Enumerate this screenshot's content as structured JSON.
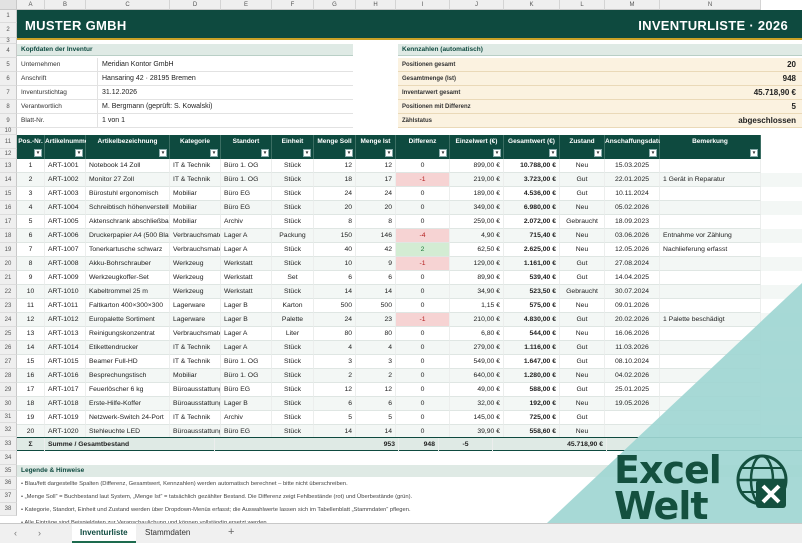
{
  "columns": [
    "A",
    "B",
    "C",
    "D",
    "E",
    "F",
    "G",
    "H",
    "I",
    "J",
    "K",
    "L",
    "M",
    "N"
  ],
  "rows": [
    "1",
    "2",
    "3",
    "4",
    "5",
    "6",
    "7",
    "8",
    "9",
    "10",
    "11",
    "12",
    "13",
    "14",
    "15",
    "16",
    "17",
    "18",
    "19",
    "20",
    "21",
    "22",
    "23",
    "24",
    "25",
    "26",
    "27",
    "28",
    "29",
    "30",
    "31",
    "32",
    "33",
    "34",
    "35",
    "36",
    "37",
    "38"
  ],
  "banner": {
    "company": "MUSTER GMBH",
    "title": "INVENTURLISTE  ·  2026"
  },
  "header_block": {
    "title": "Kopfdaten der Inventur",
    "items": [
      {
        "label": "Unternehmen",
        "value": "Meridian Kontor GmbH"
      },
      {
        "label": "Anschrift",
        "value": "Hansaring 42 · 28195 Bremen"
      },
      {
        "label": "Inventurstichtag",
        "value": "31.12.2026"
      },
      {
        "label": "Verantwortlich",
        "value": "M. Bergmann   (geprüft: S. Kowalski)"
      },
      {
        "label": "Blatt-Nr.",
        "value": "1 von 1"
      }
    ]
  },
  "kpi_block": {
    "title": "Kennzahlen (automatisch)",
    "items": [
      {
        "label": "Positionen gesamt",
        "value": "20"
      },
      {
        "label": "Gesamtmenge (Ist)",
        "value": "948"
      },
      {
        "label": "Inventarwert gesamt",
        "value": "45.718,90 €"
      },
      {
        "label": "Positionen mit Differenz",
        "value": "5"
      },
      {
        "label": "Zählstatus",
        "value": "abgeschlossen"
      }
    ]
  },
  "table": {
    "headers": [
      "Pos.-Nr.",
      "Artikelnummer",
      "Artikelbezeichnung",
      "Kategorie",
      "Standort",
      "Einheit",
      "Menge Soll",
      "Menge Ist",
      "Differenz",
      "Einzelwert (€)",
      "Gesamtwert (€)",
      "Zustand",
      "Anschaffungsdatum",
      "Bemerkung"
    ],
    "rows": [
      [
        "1",
        "ART-1001",
        "Notebook 14 Zoll",
        "IT & Technik",
        "Büro 1. OG",
        "Stück",
        "12",
        "12",
        "0",
        "899,00 €",
        "10.788,00 €",
        "Neu",
        "15.03.2025",
        ""
      ],
      [
        "2",
        "ART-1002",
        "Monitor 27 Zoll",
        "IT & Technik",
        "Büro 1. OG",
        "Stück",
        "18",
        "17",
        "-1",
        "219,00 €",
        "3.723,00 €",
        "Gut",
        "22.01.2025",
        "1 Gerät in Reparatur"
      ],
      [
        "3",
        "ART-1003",
        "Bürostuhl ergonomisch",
        "Mobiliar",
        "Büro EG",
        "Stück",
        "24",
        "24",
        "0",
        "189,00 €",
        "4.536,00 €",
        "Gut",
        "10.11.2024",
        ""
      ],
      [
        "4",
        "ART-1004",
        "Schreibtisch höhenverstellbar",
        "Mobiliar",
        "Büro EG",
        "Stück",
        "20",
        "20",
        "0",
        "349,00 €",
        "6.980,00 €",
        "Neu",
        "05.02.2026",
        ""
      ],
      [
        "5",
        "ART-1005",
        "Aktenschrank abschließbar",
        "Mobiliar",
        "Archiv",
        "Stück",
        "8",
        "8",
        "0",
        "259,00 €",
        "2.072,00 €",
        "Gebraucht",
        "18.09.2023",
        ""
      ],
      [
        "6",
        "ART-1006",
        "Druckerpapier A4 (500 Blatt)",
        "Verbrauchsmaterial",
        "Lager A",
        "Packung",
        "150",
        "146",
        "-4",
        "4,90 €",
        "715,40 €",
        "Neu",
        "03.06.2026",
        "Entnahme vor Zählung"
      ],
      [
        "7",
        "ART-1007",
        "Tonerkartusche schwarz",
        "Verbrauchsmaterial",
        "Lager A",
        "Stück",
        "40",
        "42",
        "2",
        "62,50 €",
        "2.625,00 €",
        "Neu",
        "12.05.2026",
        "Nachlieferung erfasst"
      ],
      [
        "8",
        "ART-1008",
        "Akku-Bohrschrauber",
        "Werkzeug",
        "Werkstatt",
        "Stück",
        "10",
        "9",
        "-1",
        "129,00 €",
        "1.161,00 €",
        "Gut",
        "27.08.2024",
        ""
      ],
      [
        "9",
        "ART-1009",
        "Werkzeugkoffer-Set",
        "Werkzeug",
        "Werkstatt",
        "Set",
        "6",
        "6",
        "0",
        "89,90 €",
        "539,40 €",
        "Gut",
        "14.04.2025",
        ""
      ],
      [
        "10",
        "ART-1010",
        "Kabeltrommel 25 m",
        "Werkzeug",
        "Werkstatt",
        "Stück",
        "14",
        "14",
        "0",
        "34,90 €",
        "523,50 €",
        "Gebraucht",
        "30.07.2024",
        ""
      ],
      [
        "11",
        "ART-1011",
        "Faltkarton 400×300×300",
        "Lagerware",
        "Lager B",
        "Karton",
        "500",
        "500",
        "0",
        "1,15 €",
        "575,00 €",
        "Neu",
        "09.01.2026",
        ""
      ],
      [
        "12",
        "ART-1012",
        "Europalette Sortiment",
        "Lagerware",
        "Lager B",
        "Palette",
        "24",
        "23",
        "-1",
        "210,00 €",
        "4.830,00 €",
        "Gut",
        "20.02.2026",
        "1 Palette beschädigt"
      ],
      [
        "13",
        "ART-1013",
        "Reinigungskonzentrat",
        "Verbrauchsmaterial",
        "Lager A",
        "Liter",
        "80",
        "80",
        "0",
        "6,80 €",
        "544,00 €",
        "Neu",
        "16.06.2026",
        ""
      ],
      [
        "14",
        "ART-1014",
        "Etikettendrucker",
        "IT & Technik",
        "Lager A",
        "Stück",
        "4",
        "4",
        "0",
        "279,00 €",
        "1.116,00 €",
        "Gut",
        "11.03.2026",
        ""
      ],
      [
        "15",
        "ART-1015",
        "Beamer Full-HD",
        "IT & Technik",
        "Büro 1. OG",
        "Stück",
        "3",
        "3",
        "0",
        "549,00 €",
        "1.647,00 €",
        "Gut",
        "08.10.2024",
        ""
      ],
      [
        "16",
        "ART-1016",
        "Besprechungstisch",
        "Mobiliar",
        "Büro 1. OG",
        "Stück",
        "2",
        "2",
        "0",
        "640,00 €",
        "1.280,00 €",
        "Neu",
        "04.02.2026",
        ""
      ],
      [
        "17",
        "ART-1017",
        "Feuerlöscher 6 kg",
        "Büroausstattung",
        "Büro EG",
        "Stück",
        "12",
        "12",
        "0",
        "49,00 €",
        "588,00 €",
        "Gut",
        "25.01.2025",
        ""
      ],
      [
        "18",
        "ART-1018",
        "Erste-Hilfe-Koffer",
        "Büroausstattung",
        "Lager B",
        "Stück",
        "6",
        "6",
        "0",
        "32,00 €",
        "192,00 €",
        "Neu",
        "19.05.2026",
        ""
      ],
      [
        "19",
        "ART-1019",
        "Netzwerk-Switch 24-Port",
        "IT & Technik",
        "Archiv",
        "Stück",
        "5",
        "5",
        "0",
        "145,00 €",
        "725,00 €",
        "Gut",
        "",
        ""
      ],
      [
        "20",
        "ART-1020",
        "Stehleuchte LED",
        "Büroausstattung",
        "Büro EG",
        "Stück",
        "14",
        "14",
        "0",
        "39,90 €",
        "558,60 €",
        "Neu",
        "",
        ""
      ]
    ],
    "summary": {
      "sigma": "Σ",
      "label": "Summe / Gesamtbestand",
      "soll": "953",
      "ist": "948",
      "diff": "-5",
      "total": "45.718,90 €"
    }
  },
  "legend": {
    "title": "Legende & Hinweise",
    "lines": [
      "• Blau/fett dargestellte Spalten (Differenz, Gesamtwert, Kennzahlen) werden automatisch berechnet – bitte nicht überschreiben.",
      "• „Menge Soll“ = Buchbestand laut System, „Menge Ist“ = tatsächlich gezählter Bestand. Die Differenz zeigt Fehlbestände (rot) und Überbestände (grün).",
      "• Kategorie, Standort, Einheit und Zustand werden über Dropdown-Menüs erfasst; die Auswahlwerte lassen sich im Tabellenblatt „Stammdaten“ pflegen.",
      "• Alle Einträge sind Beispieldaten zur Veranschaulichung und können vollständig ersetzt werden."
    ]
  },
  "tabs": {
    "prev": "‹",
    "next": "›",
    "sheet1": "Inventurliste",
    "sheet2": "Stammdaten",
    "add": "+"
  },
  "watermark": {
    "line1": "Excel",
    "line2": "Welt"
  },
  "colors": {
    "primary": "#0e4a3f",
    "accent": "#c9a227",
    "kpi_bg": "#fbf2e0",
    "negative": "#b52020",
    "positive": "#1f7a3a"
  }
}
